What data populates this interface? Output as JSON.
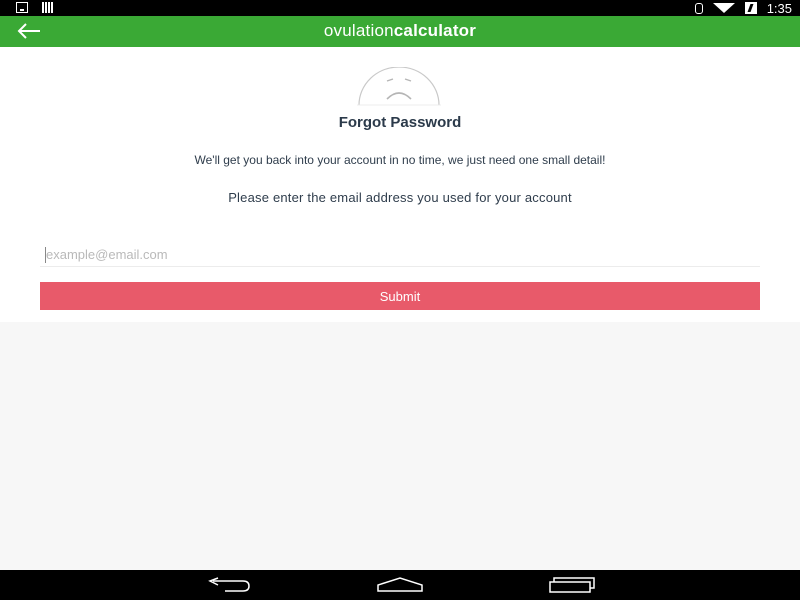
{
  "status_bar": {
    "time": "1:35",
    "icons": [
      "download-notification-icon",
      "signal-bars-icon",
      "bluetooth-icon",
      "wifi-icon",
      "battery-charging-icon"
    ]
  },
  "app_bar": {
    "back_icon": "back-arrow-icon",
    "logo_part1": "ovulation",
    "logo_part2": "calculator",
    "background": "#3aa935"
  },
  "page": {
    "face_icon": "sad-face-icon",
    "title": "Forgot Password",
    "message1": "We'll get you back into your account in no time, we just need one small detail!",
    "message2": "Please enter the email address you used for your account",
    "email_placeholder": "example@email.com",
    "email_value": "",
    "submit_label": "Submit",
    "submit_color": "#e85a6a"
  },
  "nav_bar": {
    "buttons": [
      "nav-back-icon",
      "nav-home-icon",
      "nav-recents-icon"
    ]
  }
}
